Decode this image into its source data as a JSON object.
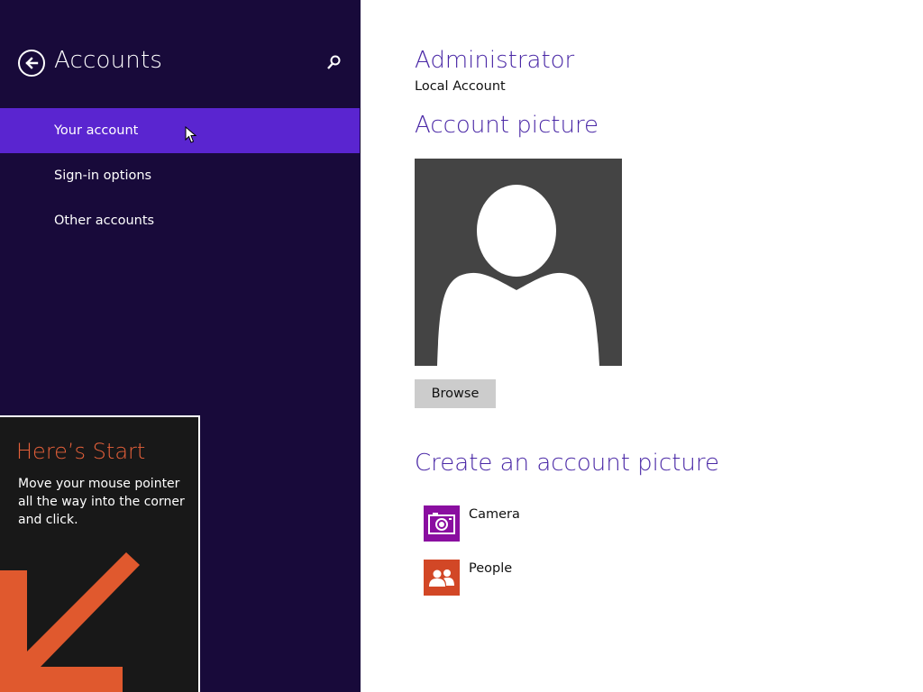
{
  "left_pane": {
    "title": "Accounts",
    "nav_items": [
      {
        "label": "Your account",
        "selected": true
      },
      {
        "label": "Sign-in options",
        "selected": false
      },
      {
        "label": "Other accounts",
        "selected": false
      }
    ]
  },
  "tip": {
    "title": "Here’s Start",
    "text": "Move your mouse pointer all the way into the corner and click."
  },
  "account": {
    "name": "Administrator",
    "type": "Local Account",
    "picture_heading": "Account picture",
    "browse_label": "Browse",
    "create_heading": "Create an account picture",
    "apps": [
      {
        "label": "Camera",
        "icon": "camera-icon",
        "color": "#8a0ea0"
      },
      {
        "label": "People",
        "icon": "people-icon",
        "color": "#d24726"
      }
    ]
  },
  "colors": {
    "left_pane_bg": "#180a3a",
    "selected_item_bg": "#5a25d0",
    "heading_purple": "#4a28a6",
    "tip_accent": "#e5603a",
    "picture_bg": "#444444",
    "browse_bg": "#cccccc"
  }
}
